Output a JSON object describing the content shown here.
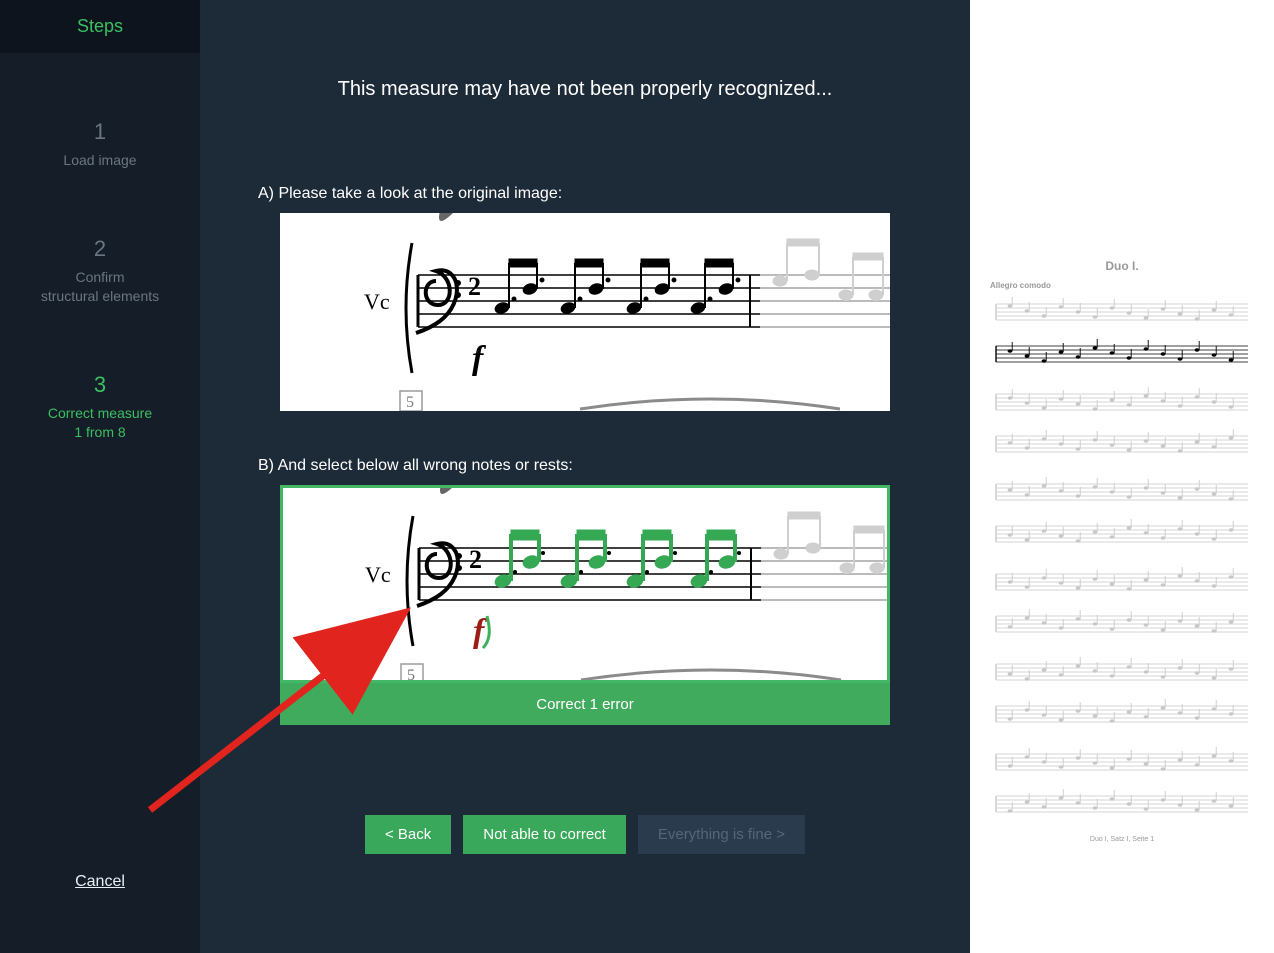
{
  "sidebar": {
    "header": "Steps",
    "steps": [
      {
        "num": "1",
        "label": "Load image",
        "active": false
      },
      {
        "num": "2",
        "label": "Confirm\nstructural elements",
        "active": false
      },
      {
        "num": "3",
        "label": "Correct measure\n1 from 8",
        "active": true
      }
    ],
    "cancel": "Cancel"
  },
  "main": {
    "title": "This measure may have not been properly recognized...",
    "section_a": "A) Please take a look at the original image:",
    "section_b": "B) And select below all wrong notes or rests:",
    "instrument_label": "Vc",
    "dynamic_mark": "f",
    "time_sig_top": "2",
    "measure_number": "5",
    "correct_bar": "Correct 1 error",
    "buttons": {
      "back": "< Back",
      "not_able": "Not able to correct",
      "fine": "Everything is fine >"
    }
  },
  "preview": {
    "title": "Duo I.",
    "tempo": "Allegro comodo",
    "footer": "Duo I, Satz I,   Seite 1",
    "systems": 6
  },
  "colors": {
    "accent": "#3dbf63",
    "bg_dark": "#1d2a38",
    "bg_darker": "#141d28",
    "btn_green": "#39a85a",
    "arrow_red": "#e1241d"
  }
}
